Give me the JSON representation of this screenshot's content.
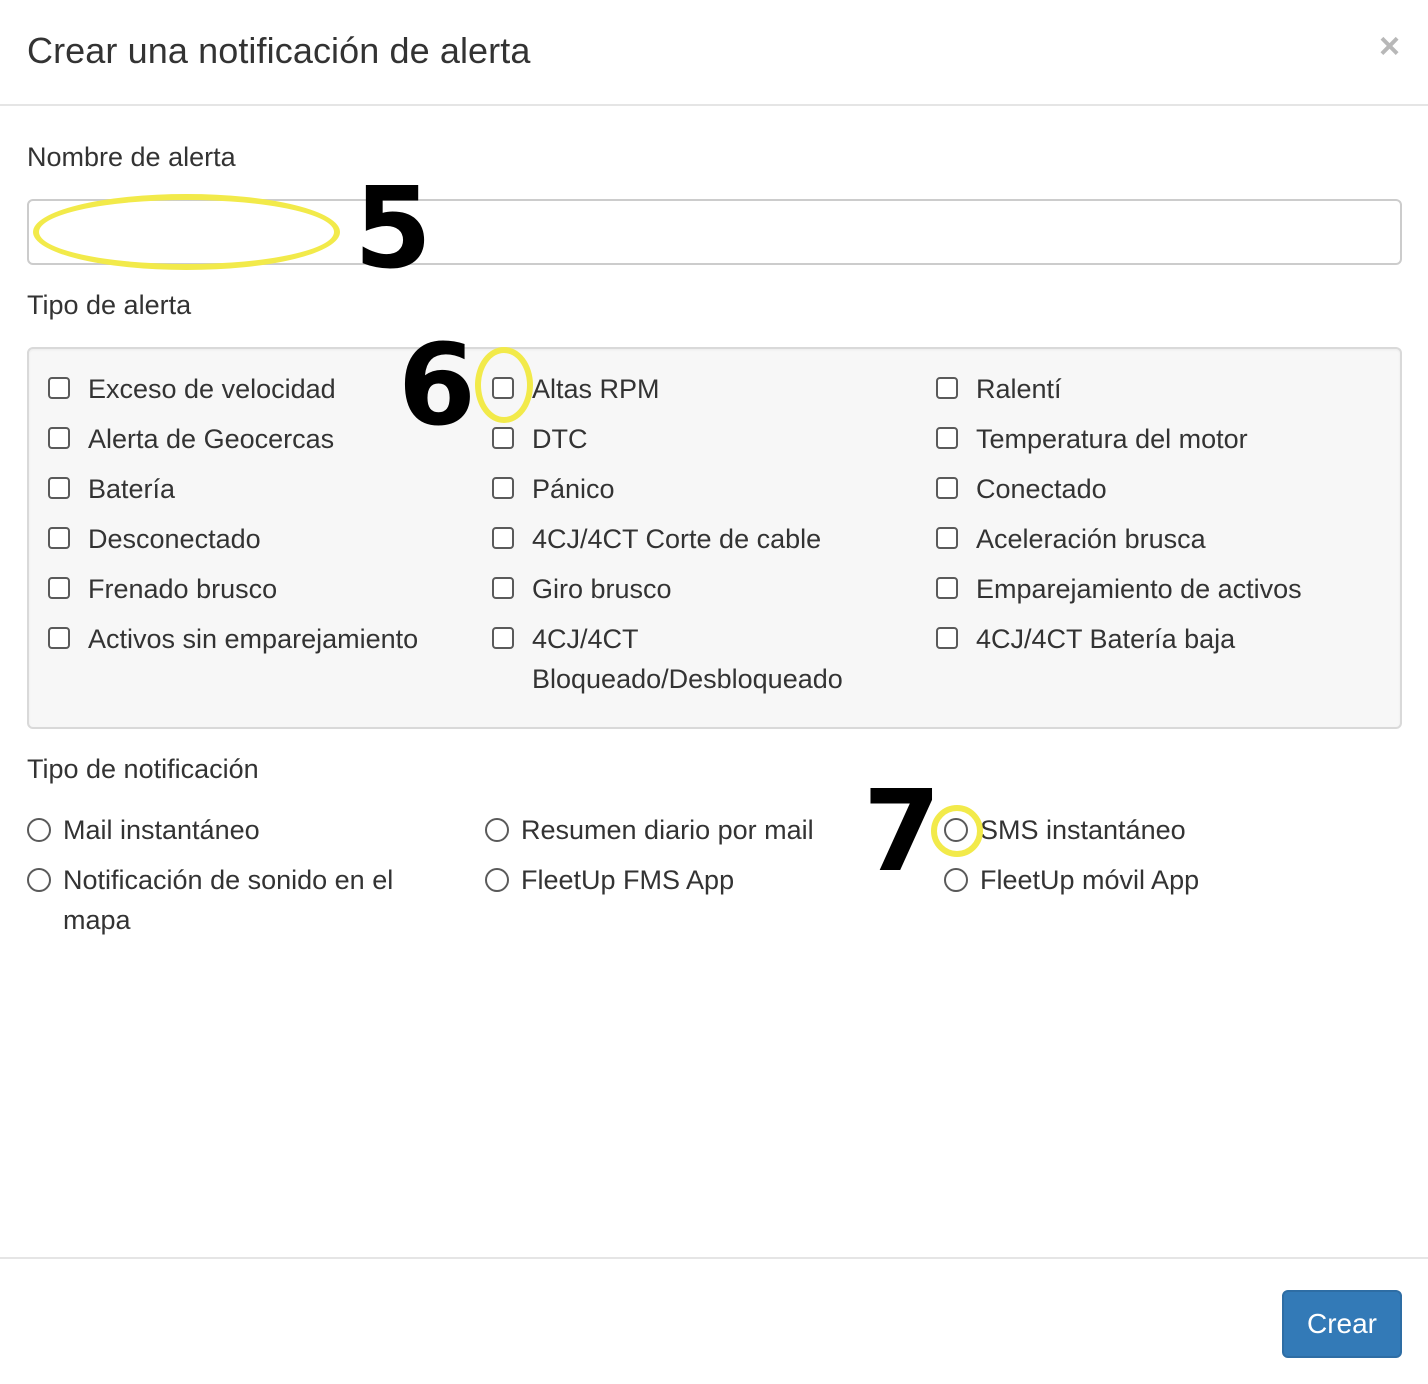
{
  "modal": {
    "title": "Crear una notificación de alerta",
    "close_symbol": "×"
  },
  "alert_name": {
    "label": "Nombre de alerta",
    "value": "",
    "placeholder": ""
  },
  "alert_type": {
    "label": "Tipo de alerta",
    "options": [
      {
        "label": "Exceso de velocidad",
        "checked": false
      },
      {
        "label": "Altas RPM",
        "checked": false
      },
      {
        "label": "Ralentí",
        "checked": false
      },
      {
        "label": "Alerta de Geocercas",
        "checked": false
      },
      {
        "label": "DTC",
        "checked": false
      },
      {
        "label": "Temperatura del motor",
        "checked": false
      },
      {
        "label": "Batería",
        "checked": false
      },
      {
        "label": "Pánico",
        "checked": false
      },
      {
        "label": "Conectado",
        "checked": false
      },
      {
        "label": "Desconectado",
        "checked": false
      },
      {
        "label": "4CJ/4CT Corte de cable",
        "checked": false
      },
      {
        "label": "Aceleración brusca",
        "checked": false
      },
      {
        "label": "Frenado brusco",
        "checked": false
      },
      {
        "label": "Giro brusco",
        "checked": false
      },
      {
        "label": "Emparejamiento de activos",
        "checked": false
      },
      {
        "label": "Activos sin emparejamiento",
        "checked": false
      },
      {
        "label": "4CJ/4CT Bloqueado/Desbloqueado",
        "checked": false
      },
      {
        "label": "4CJ/4CT Batería baja",
        "checked": false
      }
    ]
  },
  "notification_type": {
    "label": "Tipo de notificación",
    "options": [
      {
        "label": "Mail instantáneo",
        "selected": false
      },
      {
        "label": "Resumen diario por mail",
        "selected": false
      },
      {
        "label": "SMS instantáneo",
        "selected": false
      },
      {
        "label": "Notificación de sonido en el mapa",
        "selected": false
      },
      {
        "label": "FleetUp FMS App",
        "selected": false
      },
      {
        "label": "FleetUp móvil App",
        "selected": false
      }
    ]
  },
  "footer": {
    "create_label": "Crear"
  },
  "annotations": {
    "step5": "5",
    "step6": "6",
    "step7": "7",
    "highlight_color": "#f2ea4a"
  },
  "colors": {
    "primary_button": "#337ab7",
    "panel_background": "#f7f7f7"
  }
}
